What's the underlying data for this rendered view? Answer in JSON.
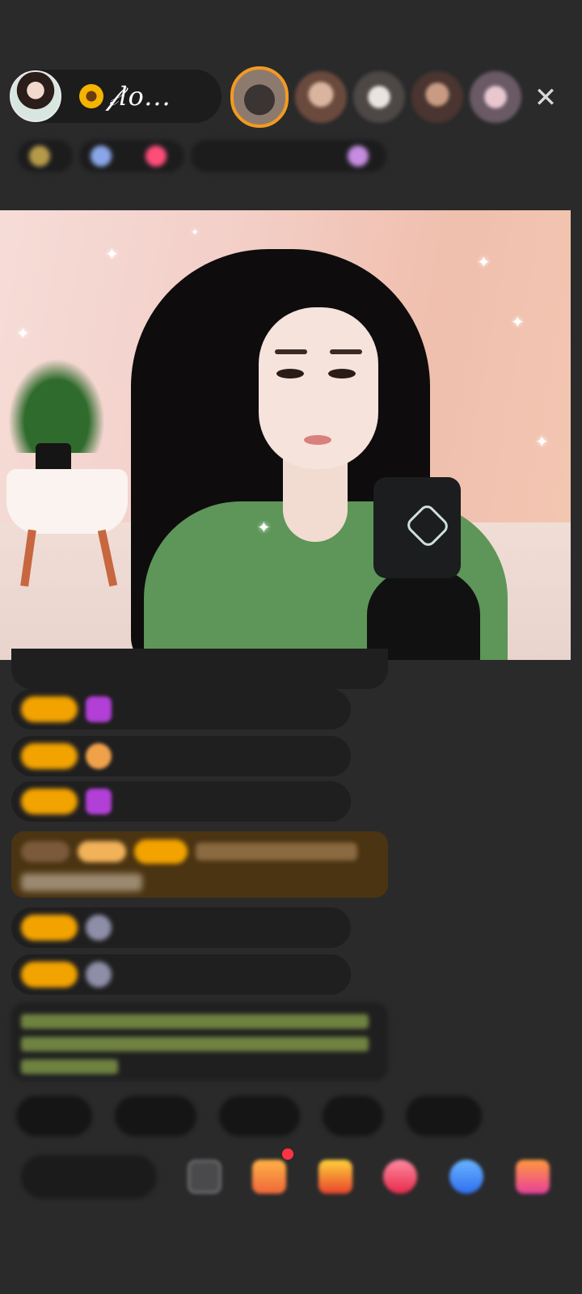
{
  "header": {
    "host_name": "𝒻lo..."
  },
  "icons": {
    "close": "close-icon",
    "sunflower": "sunflower-icon"
  },
  "colors": {
    "background": "#2a2a2b",
    "badge_orange": "#f2a300",
    "gift_highlight": "#4b3412",
    "notice_green": "#a7c35b"
  }
}
